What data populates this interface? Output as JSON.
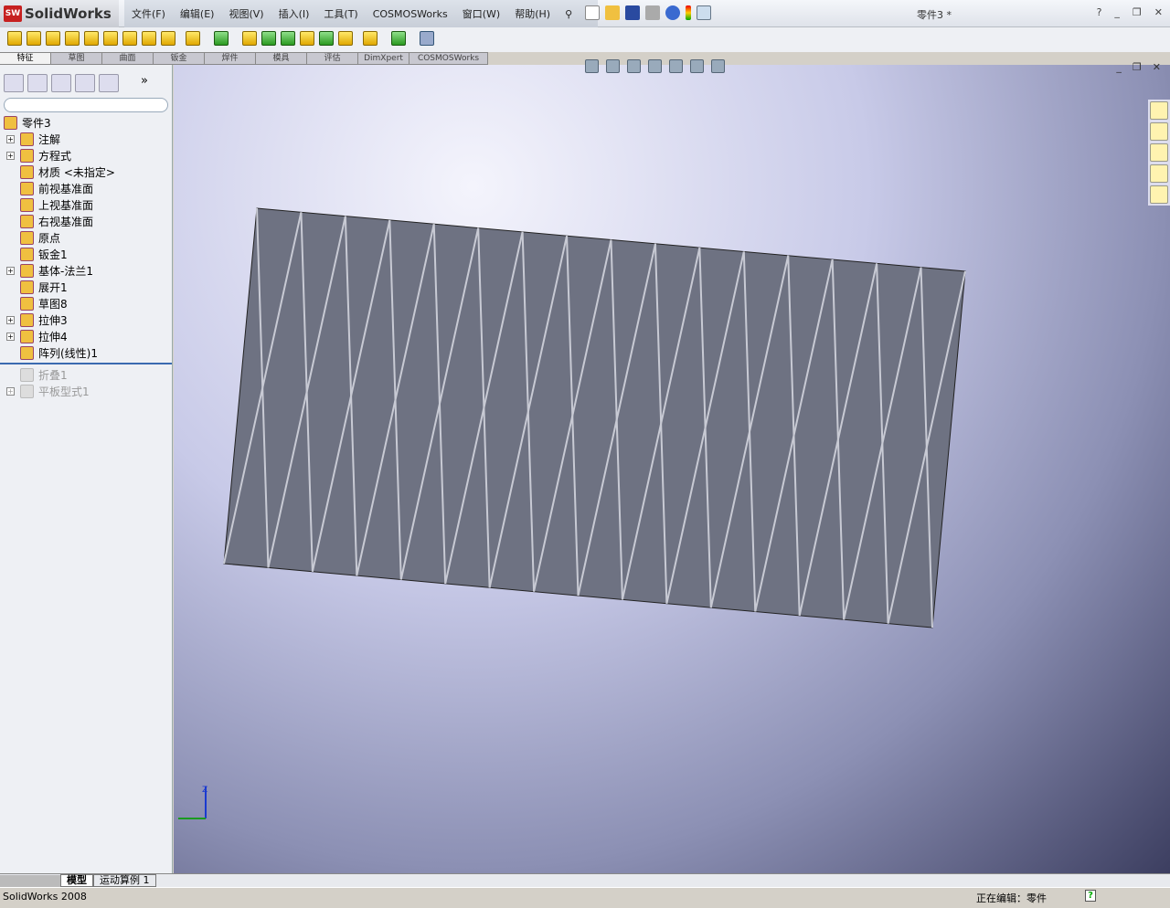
{
  "app": {
    "name": "SolidWorks",
    "doc_title": "零件3 *",
    "version": "SolidWorks 2008"
  },
  "menu": [
    "文件(F)",
    "编辑(E)",
    "视图(V)",
    "插入(I)",
    "工具(T)",
    "COSMOSWorks",
    "窗口(W)",
    "帮助(H)"
  ],
  "tabs": [
    "特征",
    "草图",
    "曲面",
    "钣金",
    "焊件",
    "模具",
    "评估",
    "DimXpert",
    "COSMOSWorks"
  ],
  "tree": {
    "root": "零件3",
    "items": [
      {
        "label": "注解",
        "expand": true,
        "icon": "annotation-icon"
      },
      {
        "label": "方程式",
        "expand": true,
        "icon": "equation-icon"
      },
      {
        "label": "材质 <未指定>",
        "expand": false,
        "icon": "material-icon"
      },
      {
        "label": "前视基准面",
        "expand": false,
        "icon": "plane-icon"
      },
      {
        "label": "上视基准面",
        "expand": false,
        "icon": "plane-icon"
      },
      {
        "label": "右视基准面",
        "expand": false,
        "icon": "plane-icon"
      },
      {
        "label": "原点",
        "expand": false,
        "icon": "origin-icon"
      },
      {
        "label": "钣金1",
        "expand": false,
        "icon": "sheet-metal-icon"
      },
      {
        "label": "基体-法兰1",
        "expand": true,
        "icon": "base-flange-icon"
      },
      {
        "label": "展开1",
        "expand": false,
        "icon": "unfold-icon"
      },
      {
        "label": "草图8",
        "expand": false,
        "icon": "sketch-icon"
      },
      {
        "label": "拉伸3",
        "expand": true,
        "icon": "extrude-icon"
      },
      {
        "label": "拉伸4",
        "expand": true,
        "icon": "extrude-icon"
      },
      {
        "label": "阵列(线性)1",
        "expand": false,
        "icon": "linear-pattern-icon"
      }
    ],
    "suppressed": [
      {
        "label": "折叠1",
        "expand": false,
        "icon": "fold-icon"
      },
      {
        "label": "平板型式1",
        "expand": true,
        "icon": "flat-pattern-icon"
      }
    ]
  },
  "bottom_tabs": [
    "模型",
    "运动算例 1"
  ],
  "status": {
    "editing": "正在编辑：零件",
    "help": "?"
  },
  "colors": {
    "part": "#6e7282",
    "viewport_top": "#f4f4fc",
    "viewport_bottom": "#3c3e60"
  }
}
